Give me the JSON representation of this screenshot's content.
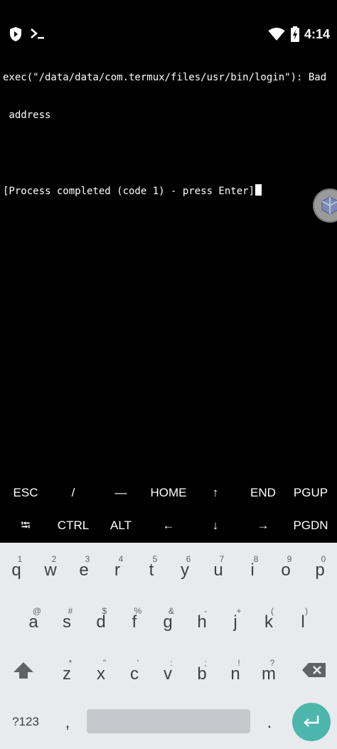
{
  "status_bar": {
    "time": "4:14",
    "icons": [
      "play-protect-icon",
      "termux-icon",
      "wifi-icon",
      "battery-charging-icon"
    ]
  },
  "terminal": {
    "lines": [
      "exec(\"/data/data/com.termux/files/usr/bin/login\"): Bad",
      " address",
      "",
      "[Process completed (code 1) - press Enter]"
    ]
  },
  "floating_bubble": {
    "icon": "floating-window-icon"
  },
  "extra_keys": {
    "row1": [
      "ESC",
      "/",
      "—",
      "HOME",
      "↑",
      "END",
      "PGUP"
    ],
    "row2": [
      "⭾",
      "CTRL",
      "ALT",
      "←",
      "↓",
      "→",
      "PGDN"
    ]
  },
  "keyboard": {
    "row1": [
      {
        "key": "q",
        "hint": "1"
      },
      {
        "key": "w",
        "hint": "2"
      },
      {
        "key": "e",
        "hint": "3"
      },
      {
        "key": "r",
        "hint": "4"
      },
      {
        "key": "t",
        "hint": "5"
      },
      {
        "key": "y",
        "hint": "6"
      },
      {
        "key": "u",
        "hint": "7"
      },
      {
        "key": "i",
        "hint": "8"
      },
      {
        "key": "o",
        "hint": "9"
      },
      {
        "key": "p",
        "hint": "0"
      }
    ],
    "row2": [
      {
        "key": "a",
        "hint": "@"
      },
      {
        "key": "s",
        "hint": "#"
      },
      {
        "key": "d",
        "hint": "$"
      },
      {
        "key": "f",
        "hint": "%"
      },
      {
        "key": "g",
        "hint": "&"
      },
      {
        "key": "h",
        "hint": "-"
      },
      {
        "key": "j",
        "hint": "+"
      },
      {
        "key": "k",
        "hint": "("
      },
      {
        "key": "l",
        "hint": ")"
      }
    ],
    "row3": [
      {
        "key": "z",
        "hint": "*"
      },
      {
        "key": "x",
        "hint": "\""
      },
      {
        "key": "c",
        "hint": "'"
      },
      {
        "key": "v",
        "hint": ":"
      },
      {
        "key": "b",
        "hint": ";"
      },
      {
        "key": "n",
        "hint": "!"
      },
      {
        "key": "m",
        "hint": "?"
      }
    ],
    "symbols_label": "?123",
    "comma": ",",
    "period": ".",
    "accent_color": "#4db6ac"
  }
}
